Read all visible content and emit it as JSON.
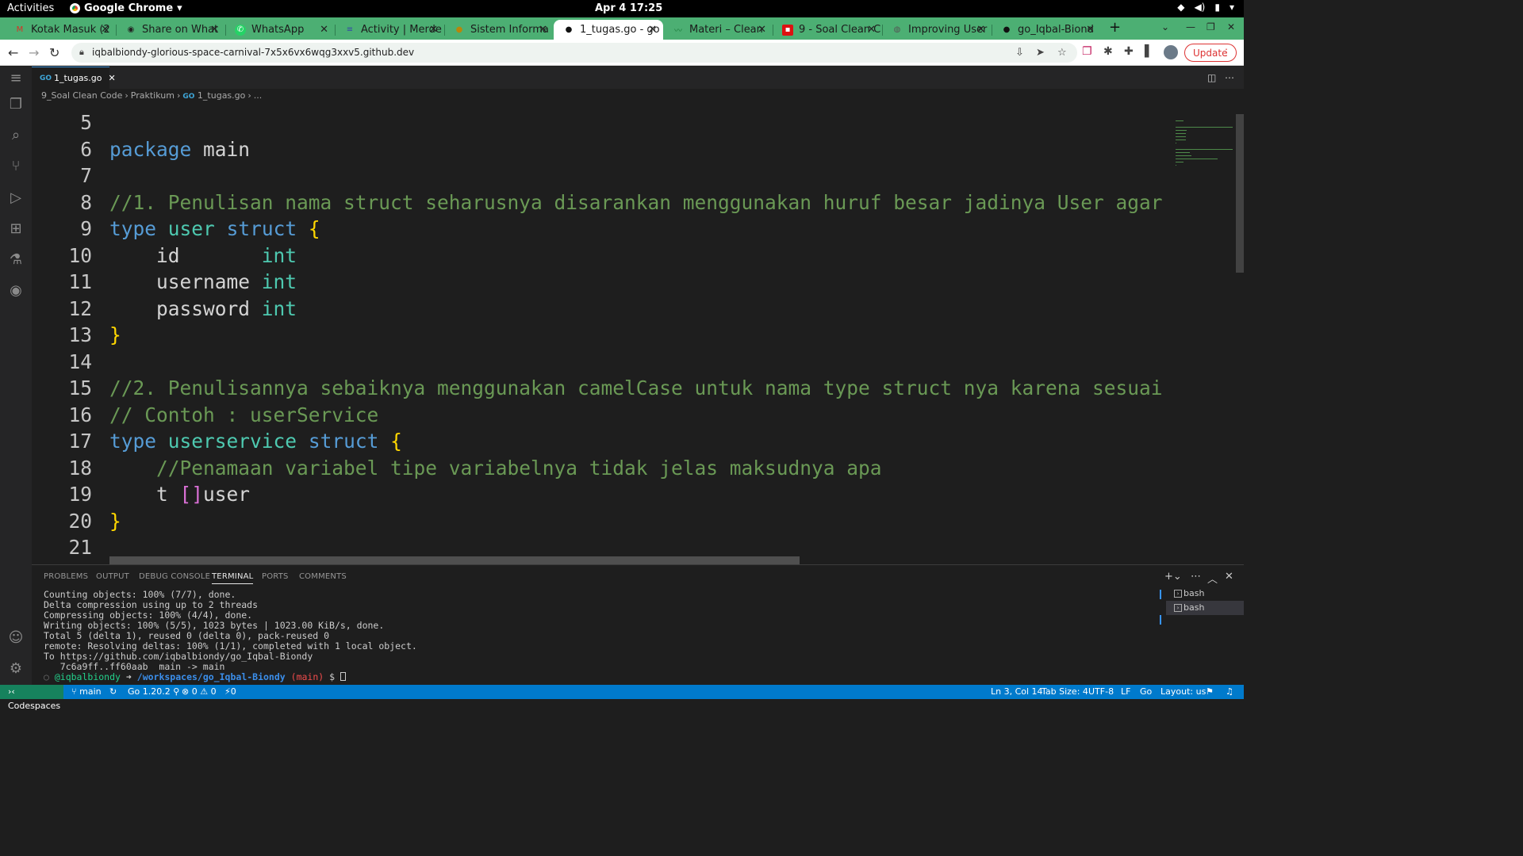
{
  "os_bar": {
    "activities": "Activities",
    "app_name": "Google Chrome",
    "clock": "Apr 4  17:25"
  },
  "browser": {
    "tabs": [
      {
        "label": "Kotak Masuk (2",
        "icon": "gmail-icon"
      },
      {
        "label": "Share on What",
        "icon": "share-icon"
      },
      {
        "label": "WhatsApp",
        "icon": "whatsapp-icon"
      },
      {
        "label": "Activity | Merde",
        "icon": "activity-icon"
      },
      {
        "label": "Sistem Informa",
        "icon": "system-icon"
      },
      {
        "label": "1_tugas.go - go",
        "icon": "github-icon"
      },
      {
        "label": "Materi – Clean",
        "icon": "materi-icon"
      },
      {
        "label": "9 - Soal Clean C",
        "icon": "pdf-icon"
      },
      {
        "label": "Improving User",
        "icon": "globe-icon"
      },
      {
        "label": "go_Iqbal-Biond",
        "icon": "github-icon"
      }
    ],
    "url": "iqbalbiondy-glorious-space-carnival-7x5x6vx6wqg3xxv5.github.dev",
    "update_label": "Update"
  },
  "editor": {
    "tab_label": "1_tugas.go",
    "breadcrumbs": [
      "9_Soal Clean Code",
      "Praktikum",
      "1_tugas.go",
      "..."
    ],
    "lines": [
      {
        "n": "5",
        "tokens": []
      },
      {
        "n": "6",
        "tokens": [
          {
            "t": "package",
            "c": "kw"
          },
          {
            "t": " main",
            "c": "tx"
          }
        ]
      },
      {
        "n": "7",
        "tokens": []
      },
      {
        "n": "8",
        "tokens": [
          {
            "t": "//1. Penulisan nama struct seharusnya disarankan menggunakan huruf besar jadinya User agar",
            "c": "cm"
          }
        ]
      },
      {
        "n": "9",
        "tokens": [
          {
            "t": "type",
            "c": "kw"
          },
          {
            "t": " ",
            "c": "tx"
          },
          {
            "t": "user",
            "c": "ty"
          },
          {
            "t": " ",
            "c": "tx"
          },
          {
            "t": "struct",
            "c": "kw"
          },
          {
            "t": " ",
            "c": "tx"
          },
          {
            "t": "{",
            "c": "br1"
          }
        ]
      },
      {
        "n": "10",
        "tokens": [
          {
            "t": "    id       ",
            "c": "tx"
          },
          {
            "t": "int",
            "c": "ty"
          }
        ]
      },
      {
        "n": "11",
        "tokens": [
          {
            "t": "    username ",
            "c": "tx"
          },
          {
            "t": "int",
            "c": "ty"
          }
        ]
      },
      {
        "n": "12",
        "tokens": [
          {
            "t": "    password ",
            "c": "tx"
          },
          {
            "t": "int",
            "c": "ty"
          }
        ]
      },
      {
        "n": "13",
        "tokens": [
          {
            "t": "}",
            "c": "br1"
          }
        ]
      },
      {
        "n": "14",
        "tokens": []
      },
      {
        "n": "15",
        "tokens": [
          {
            "t": "//2. Penulisannya sebaiknya menggunakan camelCase untuk nama type struct nya karena sesuai",
            "c": "cm"
          }
        ]
      },
      {
        "n": "16",
        "tokens": [
          {
            "t": "// Contoh : userService",
            "c": "cm"
          }
        ]
      },
      {
        "n": "17",
        "tokens": [
          {
            "t": "type",
            "c": "kw"
          },
          {
            "t": " ",
            "c": "tx"
          },
          {
            "t": "userservice",
            "c": "ty"
          },
          {
            "t": " ",
            "c": "tx"
          },
          {
            "t": "struct",
            "c": "kw"
          },
          {
            "t": " ",
            "c": "tx"
          },
          {
            "t": "{",
            "c": "br1"
          }
        ]
      },
      {
        "n": "18",
        "tokens": [
          {
            "t": "    ",
            "c": "tx"
          },
          {
            "t": "//Penamaan variabel tipe variabelnya tidak jelas maksudnya apa",
            "c": "cm"
          }
        ]
      },
      {
        "n": "19",
        "tokens": [
          {
            "t": "    t ",
            "c": "tx"
          },
          {
            "t": "[]",
            "c": "br2"
          },
          {
            "t": "user",
            "c": "tx"
          }
        ]
      },
      {
        "n": "20",
        "tokens": [
          {
            "t": "}",
            "c": "br1"
          }
        ]
      },
      {
        "n": "21",
        "tokens": []
      }
    ]
  },
  "panel": {
    "tabs": [
      "PROBLEMS",
      "OUTPUT",
      "DEBUG CONSOLE",
      "TERMINAL",
      "PORTS",
      "COMMENTS"
    ],
    "active_tab": "TERMINAL",
    "terminal_lines": [
      "Counting objects: 100% (7/7), done.",
      "Delta compression using up to 2 threads",
      "Compressing objects: 100% (4/4), done.",
      "Writing objects: 100% (5/5), 1023 bytes | 1023.00 KiB/s, done.",
      "Total 5 (delta 1), reused 0 (delta 0), pack-reused 0",
      "remote: Resolving deltas: 100% (1/1), completed with 1 local object.",
      "To https://github.com/iqbalbiondy/go_Iqbal-Biondy",
      "   7c6a9ff..ff60aab  main -> main"
    ],
    "prompt": {
      "user": "@iqbalbiondy",
      "arrow": "➜",
      "path": "/workspaces/go_Iqbal-Biondy",
      "branch": "(main)",
      "symbol": "$"
    },
    "terminals": [
      "bash",
      "bash"
    ]
  },
  "statusbar": {
    "remote": "Codespaces",
    "branch": "main",
    "go_version": "Go 1.20.2",
    "problems": "⊗ 0 ⚠ 0",
    "ports": "0",
    "cursor": "Ln 3, Col 14",
    "tab_size": "Tab Size: 4",
    "encoding": "UTF-8",
    "eol": "LF",
    "language": "Go",
    "layout": "Layout: us"
  },
  "colors": {
    "tab_strip": "#4caf73",
    "status_bar": "#007acc",
    "keyword": "#569cd6",
    "type": "#4ec9b0",
    "comment": "#6a9955"
  }
}
